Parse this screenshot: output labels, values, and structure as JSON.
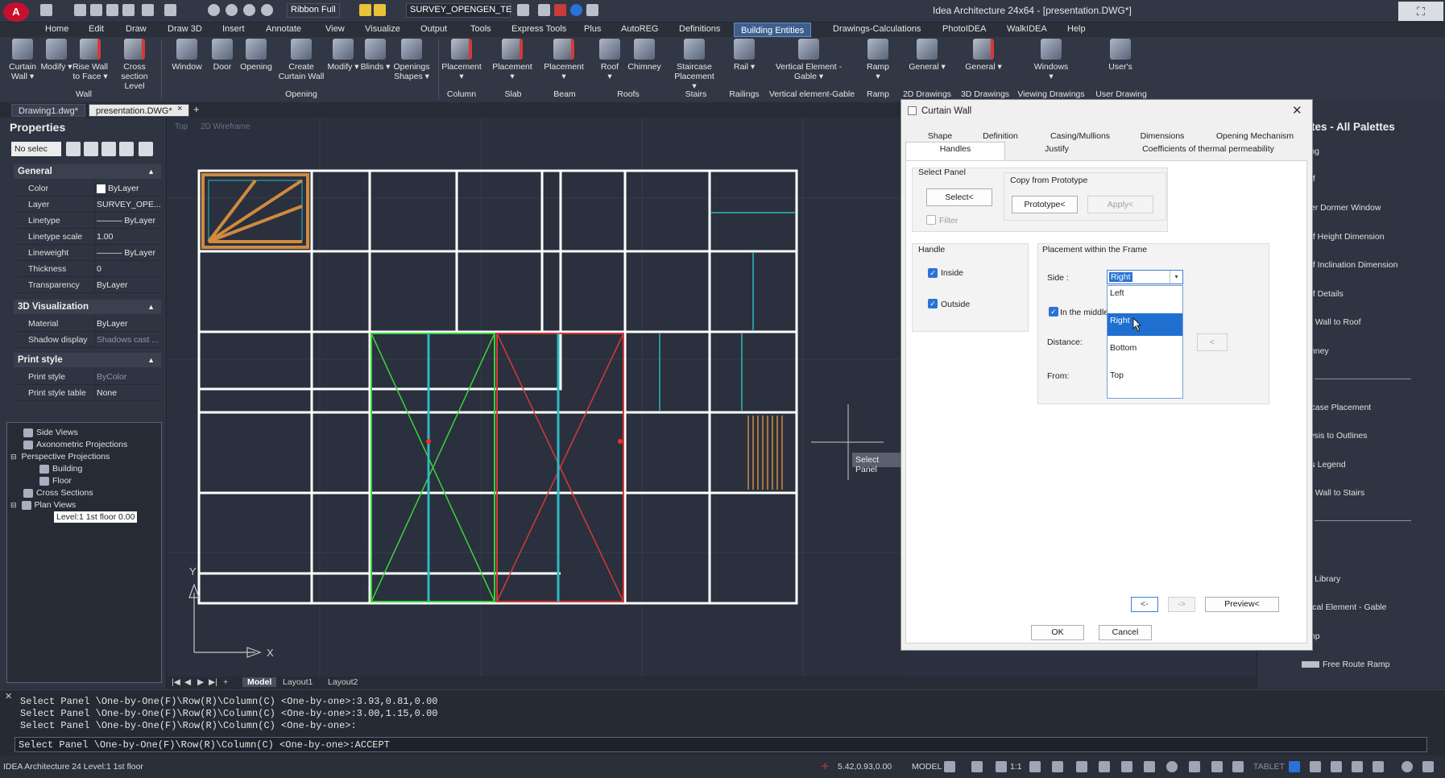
{
  "app": {
    "logo": "A",
    "window_title": "Idea Architecture 24x64 - [presentation.DWG*]",
    "ribbon_toggle": "Ribbon Full",
    "layer_selector": "SURVEY_OPENGEN_TE",
    "window_controls": "⛶"
  },
  "menu": [
    "Home",
    "Edit",
    "Draw",
    "Draw 3D",
    "Insert",
    "Annotate",
    "View",
    "Visualize",
    "Output",
    "Tools",
    "Express Tools",
    "Plus",
    "AutoREG",
    "Definitions",
    "Building Entities",
    "Drawings-Calculations",
    "PhotoIDEA",
    "WalkIDEA",
    "Help"
  ],
  "active_menu": "Building Entities",
  "ribbon": {
    "buttons": [
      "Curtain Wall ▾",
      "Modify ▾",
      "Rise Wall to Face ▾",
      "Cross section Level",
      "Window",
      "Door",
      "Opening",
      "Create Curtain Wall",
      "Modify ▾",
      "Blinds ▾",
      "Openings Shapes ▾",
      "Placement ▾",
      "Placement ▾",
      "Placement ▾",
      "Roof ▾",
      "Chimney",
      "Staircase Placement ▾",
      "Rail ▾",
      "Vertical Element - Gable ▾",
      "Ramp ▾",
      "General ▾",
      "General ▾",
      "Windows ▾",
      "User's"
    ],
    "groups": [
      "Wall",
      "Opening",
      "Column",
      "Slab",
      "Beam",
      "Roofs",
      "Stairs",
      "Railings",
      "Vertical element-Gable",
      "Ramp",
      "2D Drawings",
      "3D Drawings",
      "Viewing Drawings",
      "User Drawing"
    ]
  },
  "doc_tabs": [
    "Drawing1.dwg*",
    "presentation.DWG*"
  ],
  "doc_tab_close": "×",
  "doc_tab_add": "+",
  "properties": {
    "title": "Properties",
    "selection": "No selec",
    "sections": {
      "general": {
        "title": "General",
        "rows": [
          {
            "key": "Color",
            "value": "ByLayer"
          },
          {
            "key": "Layer",
            "value": "SURVEY_OPE..."
          },
          {
            "key": "Linetype",
            "value": "——— ByLayer"
          },
          {
            "key": "Linetype scale",
            "value": "1.00"
          },
          {
            "key": "Lineweight",
            "value": "——— ByLayer"
          },
          {
            "key": "Thickness",
            "value": "0"
          },
          {
            "key": "Transparency",
            "value": "ByLayer"
          }
        ]
      },
      "viz": {
        "title": "3D Visualization",
        "rows": [
          {
            "key": "Material",
            "value": "ByLayer"
          },
          {
            "key": "Shadow display",
            "value": "Shadows cast ..."
          }
        ]
      },
      "print": {
        "title": "Print style",
        "rows": [
          {
            "key": "Print style",
            "value": "ByColor"
          },
          {
            "key": "Print style table",
            "value": "None"
          }
        ]
      }
    },
    "collapse_arrow": "▲"
  },
  "tree": [
    "Side Views",
    "Axonometric Projections",
    "Perspective Projections",
    "Building",
    "Floor",
    "Cross Sections",
    "Plan Views",
    "Level:1 1st floor 0.00"
  ],
  "tree_expanders": [
    "⊟",
    "⊟"
  ],
  "viewport": {
    "view": "Top",
    "style": "2D Wireframe",
    "axis_x": "X",
    "axis_y": "Y",
    "tooltip": "Select Panel"
  },
  "model_tabs": [
    "Model",
    "Layout1",
    "Layout2"
  ],
  "model_nav": [
    "|◀",
    "◀",
    "▶",
    "▶|",
    "+"
  ],
  "palette": {
    "title": "ettes - All Palettes",
    "items": [
      "ing",
      "of",
      "ter Dormer Window",
      "of Height Dimension",
      "of Inclination Dimension",
      "of Details",
      "e Wall to Roof",
      "mney",
      "rcase Placement",
      "lysis to Outlines",
      "rs Legend",
      "e Wall to Stairs",
      "s Library",
      "tical Element - Gable",
      "mp",
      "Free Route Ramp"
    ]
  },
  "dialog": {
    "title": "Curtain Wall",
    "close": "✕",
    "tabs_row1": [
      "Shape",
      "Definition",
      "Casing/Mullions",
      "Dimensions",
      "Opening Mechanism"
    ],
    "tabs_row2": [
      "Handles",
      "Justify",
      "Coefficients of thermal permeability"
    ],
    "select_panel": {
      "title": "Select Panel",
      "select": "Select<",
      "filter": "Filter"
    },
    "copy": {
      "title": "Copy from Prototype",
      "prototype": "Prototype<",
      "apply": "Apply<"
    },
    "handle": {
      "title": "Handle",
      "inside": "Inside",
      "outside": "Outside"
    },
    "placement": {
      "title": "Placement within the Frame",
      "side": "Side :",
      "side_value": "Right",
      "in_middle": "In the middle",
      "distance": "Distance:",
      "from": "From:",
      "distance_btn": "<"
    },
    "side_options": [
      "Left",
      "Right",
      "Bottom",
      "Top"
    ],
    "side_selected": "Right",
    "nav": {
      "prev": "<-",
      "next": "->",
      "preview": "Preview<"
    },
    "ok": "OK",
    "cancel": "Cancel",
    "check_glyph": "✓"
  },
  "command": {
    "lines": [
      "Select Panel \\One-by-One(F)\\Row(R)\\Column(C) <One-by-one>:3.93,0.81,0.00",
      "Select Panel \\One-by-One(F)\\Row(R)\\Column(C) <One-by-one>:3.00,1.15,0.00",
      "Select Panel \\One-by-One(F)\\Row(R)\\Column(C) <One-by-one>:"
    ],
    "input": "Select Panel \\One-by-One(F)\\Row(R)\\Column(C) <One-by-one>:ACCEPT",
    "close": "✕"
  },
  "status": {
    "left": "IDEA Architecture 24 Level:1 1st floor",
    "coords": "5.42,0.93,0.00",
    "model": "MODEL",
    "scale": "1:1",
    "tablet": "TABLET"
  },
  "colors": {
    "accent": "#2b72d6",
    "green_panel": "#3ad33a",
    "red_panel": "#d63a3a",
    "cyan": "#2cb8c4",
    "orange": "#d08a3e"
  }
}
